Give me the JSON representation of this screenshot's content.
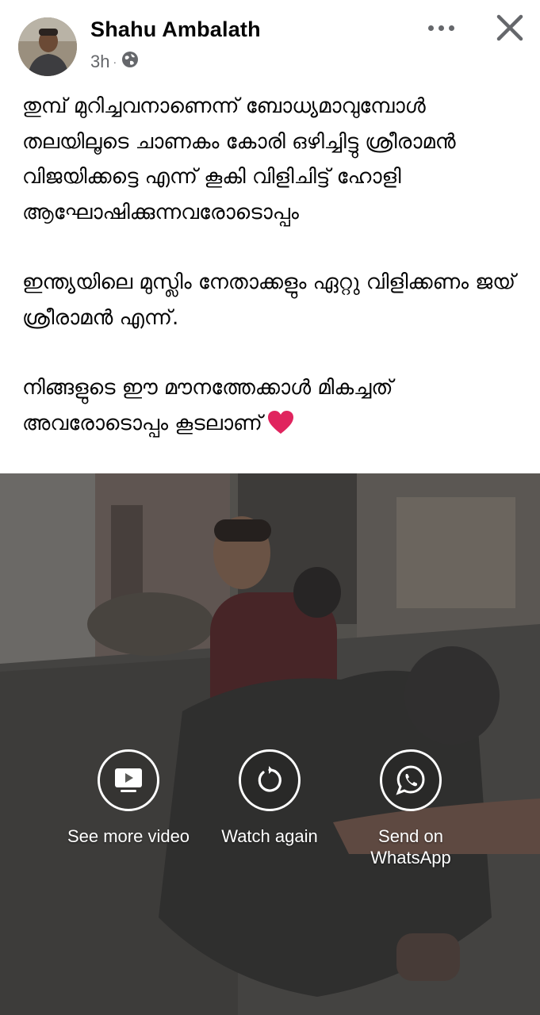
{
  "post": {
    "author": "Shahu Ambalath",
    "time": "3h",
    "audience_icon": "globe-icon",
    "paragraphs": [
      "തുമ്പ് മുറിച്ചവനാണെന്ന് ബോധ്യമാവുമ്പോൾ തലയിലൂടെ ചാണകം കോരി ഒഴിച്ചിട്ടു ശ്രീരാമൻ വിജയിക്കട്ടെ എന്ന് കൂകി വിളിചിട്ട് ഹോളി ആഘോഷിക്കുന്നവരോടൊപ്പം",
      "ഇന്ത്യയിലെ മുസ്ലിം നേതാക്കളും ഏറ്റു വിളിക്കണം ജയ് ശ്രീരാമൻ എന്ന്.",
      "നിങ്ങളുടെ ഈ മൗനത്തേക്കാൾ മികച്ചത് അവരോടൊപ്പം കൂടലാണ്"
    ],
    "end_emoji": "red-heart-icon"
  },
  "header_icons": {
    "more": "more-horizontal-icon",
    "close": "close-icon"
  },
  "video": {
    "actions": [
      {
        "label": "See more video",
        "icon": "video-play-icon"
      },
      {
        "label": "Watch again",
        "icon": "replay-icon"
      },
      {
        "label": "Send on\nWhatsApp",
        "icon": "whatsapp-icon"
      }
    ]
  },
  "colors": {
    "text_primary": "#050505",
    "text_secondary": "#65676b",
    "heart": "#e0245e"
  }
}
